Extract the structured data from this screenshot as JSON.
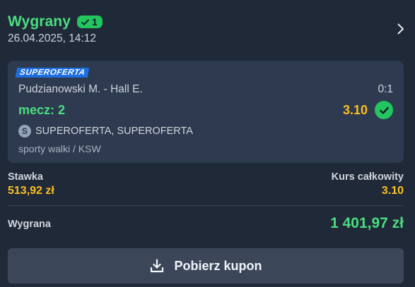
{
  "header": {
    "status": "Wygrany",
    "badge_count": "1",
    "date": "26.04.2025, 14:12"
  },
  "bet": {
    "promo_tag": "SUPEROFERTA",
    "match": "Pudzianowski M. - Hall E.",
    "score": "0:1",
    "selection": "mecz: 2",
    "odd": "3.10",
    "market_icon_letter": "S",
    "market": "SUPEROFERTA, SUPEROFERTA",
    "category": "sporty walki / KSW"
  },
  "summary": {
    "stake_label": "Stawka",
    "stake_value": "513,92 zł",
    "total_odds_label": "Kurs całkowity",
    "total_odds_value": "3.10",
    "win_label": "Wygrana",
    "win_value": "1 401,97 zł"
  },
  "actions": {
    "download_label": "Pobierz kupon"
  },
  "icons": {
    "badge_check": "check-icon",
    "chevron": "chevron-right-icon",
    "win_check": "check-circle-icon",
    "market": "superoferta-s-icon",
    "download": "download-icon"
  },
  "colors": {
    "background": "#1f2937",
    "card": "#2d3a4f",
    "win_green": "#4ade80",
    "odds_yellow": "#fbbf24",
    "promo_blue": "#1d6fe0",
    "button": "#3b4759"
  }
}
